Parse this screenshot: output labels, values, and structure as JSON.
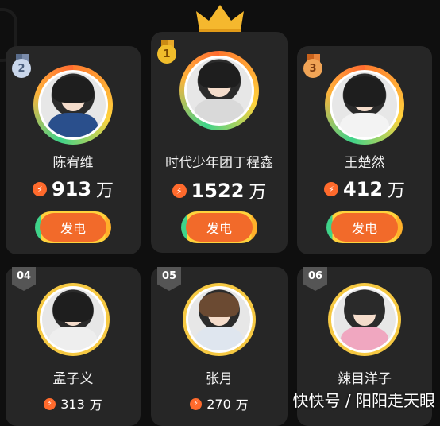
{
  "colors": {
    "accent": "#f26a2a",
    "gold": "#f5c842",
    "card_bg": "#262626"
  },
  "icons": {
    "crown": "crown-icon",
    "bolt": "lightning-bolt-icon"
  },
  "top_three": [
    {
      "rank": "1",
      "name": "时代少年团丁程鑫",
      "votes": "1522",
      "unit": "万",
      "button": "发电"
    },
    {
      "rank": "2",
      "name": "陈宥维",
      "votes": "913",
      "unit": "万",
      "button": "发电"
    },
    {
      "rank": "3",
      "name": "王楚然",
      "votes": "412",
      "unit": "万",
      "button": "发电"
    }
  ],
  "others": [
    {
      "rank": "04",
      "name": "孟子义",
      "votes": "313",
      "unit": "万"
    },
    {
      "rank": "05",
      "name": "张月",
      "votes": "270",
      "unit": "万"
    },
    {
      "rank": "06",
      "name": "辣目洋子",
      "votes": "",
      "unit": ""
    }
  ],
  "watermark": "快快号 / 阳阳走天眼"
}
